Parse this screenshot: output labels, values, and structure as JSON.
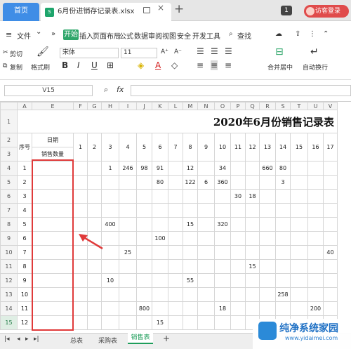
{
  "tabs": {
    "home": "首页",
    "file": "6月份进销存记录表.xlsx",
    "close": "×",
    "new": "+"
  },
  "top_right": {
    "badge": "1",
    "login": "访客登录"
  },
  "menu": {
    "file": "文件",
    "file_arrow": "⌄",
    "more": "»",
    "active": "开始",
    "items": [
      "插入",
      "页面布局",
      "公式",
      "数据",
      "审阅",
      "视图",
      "安全",
      "开发工具"
    ],
    "search": "查找"
  },
  "ribbon": {
    "cut": "剪切",
    "copy": "复制",
    "format_painter": "格式刷",
    "font_name": "宋体",
    "font_size": "11",
    "font_grow": "A⁺",
    "font_shrink": "A⁻",
    "bold": "B",
    "italic": "I",
    "underline": "U",
    "font_color": "A",
    "merge_center": "合并居中",
    "auto_wrap": "自动换行"
  },
  "formula_bar": {
    "cell_ref": "V15",
    "fx": "fx",
    "zoom_icon": "⌕"
  },
  "sheet": {
    "columns": [
      "A",
      "E",
      "F",
      "G",
      "H",
      "I",
      "J",
      "K",
      "L",
      "M",
      "N",
      "O",
      "P",
      "Q",
      "R",
      "S",
      "T",
      "U",
      "V"
    ],
    "title": "2020年6月份销售记录表",
    "header_a": "序号",
    "header_date": "日期",
    "header_qty": "销售数量",
    "days": [
      "1",
      "2",
      "3",
      "4",
      "5",
      "6",
      "7",
      "8",
      "9",
      "10",
      "11",
      "12",
      "13",
      "14",
      "15",
      "16",
      "17"
    ],
    "rows": [
      {
        "num": "4",
        "seq": "1",
        "cells": [
          "",
          "",
          "1",
          "246",
          "98",
          "91",
          "",
          "12",
          "",
          "34",
          "",
          "",
          "660",
          "80",
          "",
          "",
          ""
        ]
      },
      {
        "num": "5",
        "seq": "2",
        "cells": [
          "",
          "",
          "",
          "",
          "",
          "80",
          "",
          "122",
          "6",
          "360",
          "",
          "",
          "",
          "3",
          "",
          "",
          ""
        ]
      },
      {
        "num": "6",
        "seq": "3",
        "cells": [
          "",
          "",
          "",
          "",
          "",
          "",
          "",
          "",
          "",
          "",
          "30",
          "18",
          "",
          "",
          "",
          "",
          ""
        ]
      },
      {
        "num": "7",
        "seq": "4",
        "cells": [
          "",
          "",
          "",
          "",
          "",
          "",
          "",
          "",
          "",
          "",
          "",
          "",
          "",
          "",
          "",
          "",
          ""
        ]
      },
      {
        "num": "8",
        "seq": "5",
        "cells": [
          "",
          "",
          "400",
          "",
          "",
          "",
          "",
          "15",
          "",
          "320",
          "",
          "",
          "",
          "",
          "",
          "",
          ""
        ]
      },
      {
        "num": "9",
        "seq": "6",
        "cells": [
          "",
          "",
          "",
          "",
          "",
          "100",
          "",
          "",
          "",
          "",
          "",
          "",
          "",
          "",
          "",
          "",
          ""
        ]
      },
      {
        "num": "10",
        "seq": "7",
        "cells": [
          "",
          "",
          "",
          "25",
          "",
          "",
          "",
          "",
          "",
          "",
          "",
          "",
          "",
          "",
          "",
          "",
          "40"
        ]
      },
      {
        "num": "11",
        "seq": "8",
        "cells": [
          "",
          "",
          "",
          "",
          "",
          "",
          "",
          "",
          "",
          "",
          "",
          "15",
          "",
          "",
          "",
          "",
          ""
        ]
      },
      {
        "num": "12",
        "seq": "9",
        "cells": [
          "",
          "",
          "10",
          "",
          "",
          "",
          "",
          "55",
          "",
          "",
          "",
          "",
          "",
          "",
          "",
          "",
          ""
        ]
      },
      {
        "num": "13",
        "seq": "10",
        "cells": [
          "",
          "",
          "",
          "",
          "",
          "",
          "",
          "",
          "",
          "",
          "",
          "",
          "",
          "258",
          "",
          "",
          ""
        ]
      },
      {
        "num": "14",
        "seq": "11",
        "cells": [
          "",
          "",
          "",
          "",
          "800",
          "",
          "",
          "",
          "",
          "18",
          "",
          "",
          "",
          "",
          "",
          "200",
          ""
        ]
      },
      {
        "num": "15",
        "seq": "12",
        "cells": [
          "",
          "",
          "",
          "",
          "",
          "15",
          "",
          "",
          "",
          "",
          "",
          "",
          "",
          "",
          "",
          "",
          ""
        ]
      }
    ]
  },
  "sheet_tabs": {
    "tab1": "总表",
    "tab2": "采购表",
    "active": "销售表",
    "add": "+"
  },
  "watermark": {
    "title": "纯净系统家园",
    "url": "www.yidaimei.com"
  },
  "colors": {
    "accent_green": "#2ea66a",
    "home_blue": "#3f8de6",
    "login_red": "#e04b4b",
    "highlight_red": "#e03a3a"
  }
}
